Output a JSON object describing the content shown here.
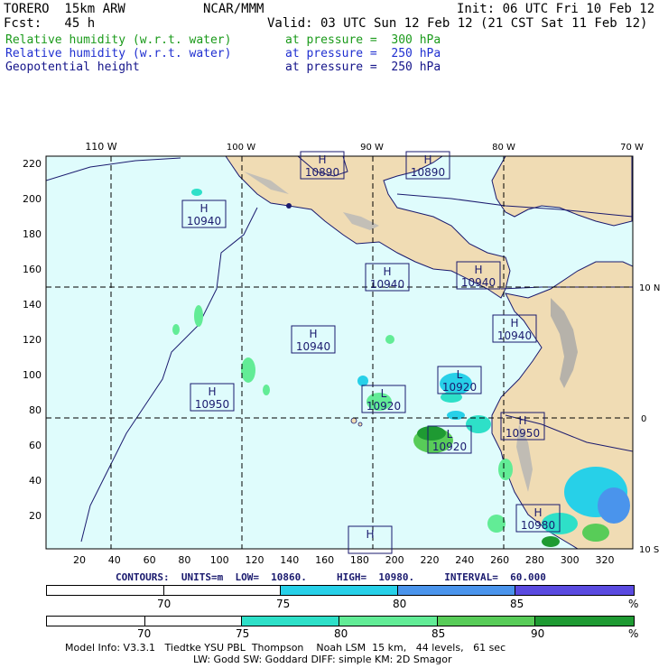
{
  "header": {
    "model": "TORERO  15km ARW",
    "org": "NCAR/MMM",
    "init": "Init: 06 UTC Fri 10 Feb 12",
    "fcst": "Fcst:   45 h",
    "valid": "Valid: 03 UTC Sun 12 Feb 12 (21 CST Sat 11 Feb 12)"
  },
  "fields": [
    {
      "name": "Relative humidity (w.r.t. water)",
      "level": "at pressure =  300 hPa",
      "color": "#1a9a1a"
    },
    {
      "name": "Relative humidity (w.r.t. water)",
      "level": "at pressure =  250 hPa",
      "color": "#1f2fd0"
    },
    {
      "name": "Geopotential height",
      "level": "at pressure =  250 hPa",
      "color": "#14148a"
    }
  ],
  "map": {
    "lon_labels": [
      "110 W",
      "100 W",
      "90 W",
      "80 W",
      "70 W"
    ],
    "lat_labels": [
      "10 N",
      "0",
      "10 S"
    ],
    "y_ticks": [
      "220",
      "200",
      "180",
      "160",
      "140",
      "120",
      "100",
      "80",
      "60",
      "40",
      "20"
    ],
    "x_ticks": [
      "20",
      "40",
      "60",
      "80",
      "100",
      "120",
      "140",
      "160",
      "180",
      "200",
      "220",
      "240",
      "260",
      "280",
      "300",
      "320"
    ],
    "h_labels": [
      {
        "type": "H",
        "value": "10890"
      },
      {
        "type": "H",
        "value": "10890"
      },
      {
        "type": "H",
        "value": "10940"
      },
      {
        "type": "H",
        "value": "10940"
      },
      {
        "type": "H",
        "value": "10940"
      },
      {
        "type": "H",
        "value": "10940"
      },
      {
        "type": "H",
        "value": "10940"
      },
      {
        "type": "L",
        "value": "10920"
      },
      {
        "type": "H",
        "value": "10950"
      },
      {
        "type": "L",
        "value": "10920"
      },
      {
        "type": "L",
        "value": "10920"
      },
      {
        "type": "H",
        "value": "10950"
      },
      {
        "type": "H",
        "value": "10980"
      },
      {
        "type": "H",
        "value": ""
      }
    ],
    "colors": {
      "ocean": "#dffcfc",
      "land": "#f0dcb4",
      "border": "#1a1a6e",
      "frame": "#000000"
    }
  },
  "contour_info": {
    "label": "CONTOURS:  UNITS=m  LOW=  10860.     HIGH=  10980.     INTERVAL=  60.000"
  },
  "colorbar1": {
    "labels": [
      "70",
      "75",
      "80",
      "85",
      "%"
    ],
    "colors": [
      "#ffffff",
      "#ffffff",
      "#27d0e8",
      "#4a94ec",
      "#5a4ae0"
    ]
  },
  "colorbar2": {
    "labels": [
      "70",
      "75",
      "80",
      "85",
      "90",
      "%"
    ],
    "colors": [
      "#ffffff",
      "#ffffff",
      "#2ee0c8",
      "#62ec96",
      "#58cc58",
      "#1e9a32"
    ]
  },
  "footer": {
    "line1": "Model Info: V3.3.1   Tiedtke YSU PBL  Thompson    Noah LSM  15 km,   44 levels,   61 sec",
    "line2": "LW: Godd SW: Goddard DIFF: simple KM: 2D Smagor"
  }
}
